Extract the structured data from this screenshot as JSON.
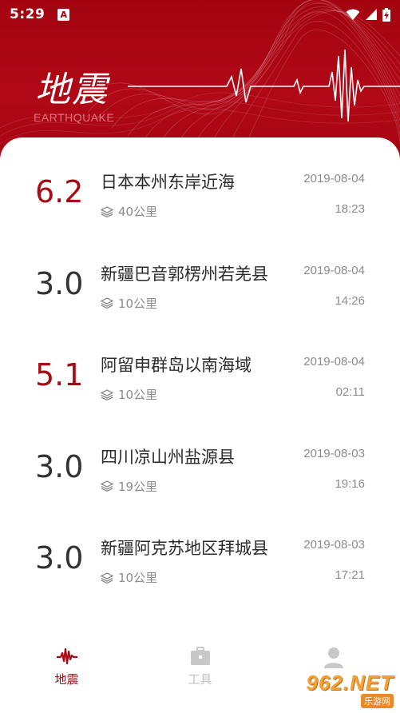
{
  "status_bar": {
    "time": "5:29",
    "notification_badge": "A"
  },
  "header": {
    "title": "地震",
    "subtitle": "EARTHQUAKE"
  },
  "earthquakes": [
    {
      "magnitude": "6.2",
      "severe": true,
      "place": "日本本州东岸近海",
      "depth": "40公里",
      "date": "2019-08-04",
      "time": "18:23"
    },
    {
      "magnitude": "3.0",
      "severe": false,
      "place": "新疆巴音郭楞州若羌县",
      "depth": "10公里",
      "date": "2019-08-04",
      "time": "14:26"
    },
    {
      "magnitude": "5.1",
      "severe": true,
      "place": "阿留申群岛以南海域",
      "depth": "10公里",
      "date": "2019-08-04",
      "time": "02:11"
    },
    {
      "magnitude": "3.0",
      "severe": false,
      "place": "四川凉山州盐源县",
      "depth": "19公里",
      "date": "2019-08-03",
      "time": "19:16"
    },
    {
      "magnitude": "3.0",
      "severe": false,
      "place": "新疆阿克苏地区拜城县",
      "depth": "10公里",
      "date": "2019-08-03",
      "time": "17:21"
    }
  ],
  "tabs": [
    {
      "label": "地震",
      "icon": "seismograph-icon",
      "active": true
    },
    {
      "label": "工具",
      "icon": "toolbox-icon",
      "active": false
    },
    {
      "label": "",
      "icon": "person-icon",
      "active": false
    }
  ],
  "watermark": {
    "top": "962.NET",
    "bottom": "乐游网"
  },
  "colors": {
    "header_red": "#a3030f",
    "accent_red": "#a80b14",
    "text_gray": "#8c8c8c"
  }
}
